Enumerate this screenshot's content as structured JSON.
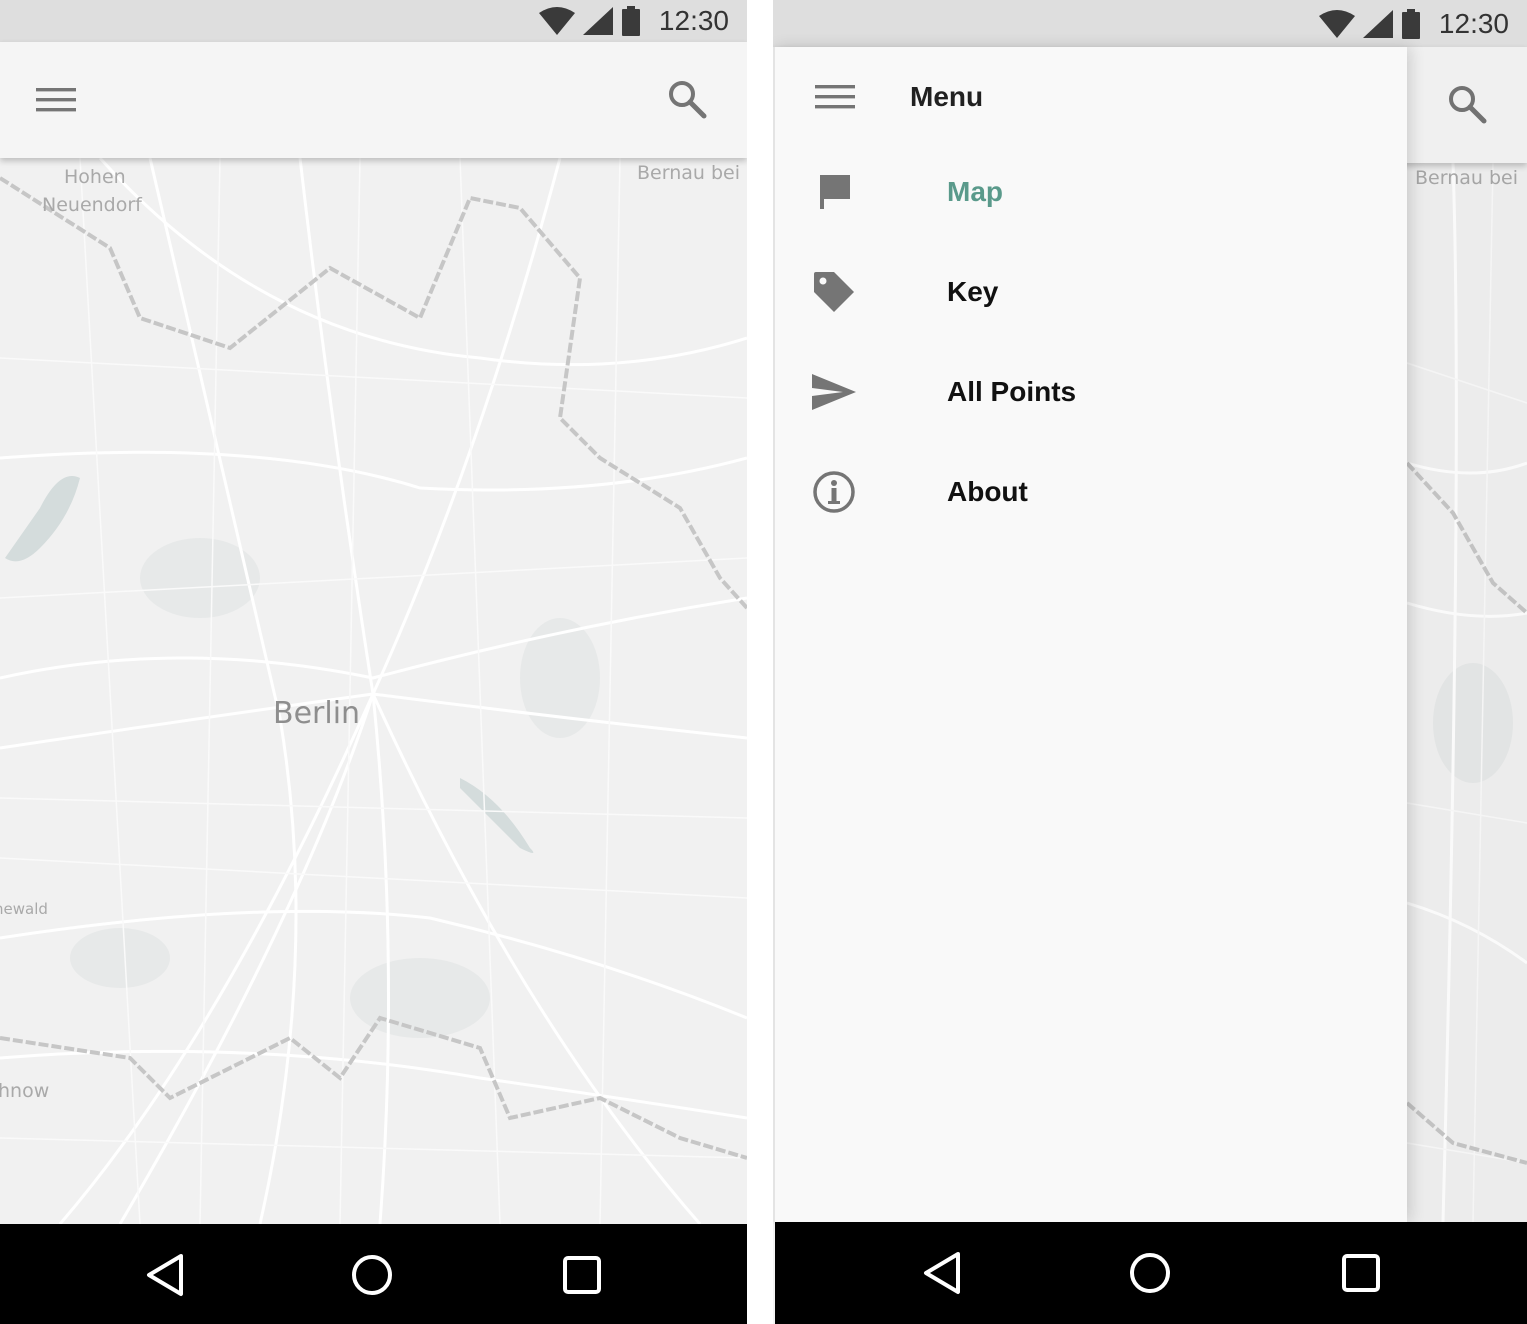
{
  "colors": {
    "accent": "#5a9a8b",
    "icon": "#757575",
    "status_bar": "#dedede",
    "app_bar": "#f5f5f5",
    "drawer": "#f9f9f9",
    "nav_bar": "#000000",
    "map_bg": "#f1f1f1"
  },
  "left_screen": {
    "status_bar": {
      "time": "12:30",
      "icons": [
        "wifi-icon",
        "cellular-signal-icon",
        "battery-icon"
      ]
    },
    "app_bar": {
      "menu_icon": "hamburger-menu-icon",
      "search_icon": "search-icon"
    },
    "map": {
      "city_label": "Berlin",
      "place_labels": {
        "hohen": "Hohen",
        "neuendorf": "Neuendorf",
        "bernau": "Bernau bei",
        "grunewald": "newald",
        "teltow": "hnow"
      }
    },
    "nav_bar": {
      "icons": [
        "back-icon",
        "home-icon",
        "recents-icon"
      ]
    }
  },
  "right_screen": {
    "status_bar": {
      "time": "12:30",
      "icons": [
        "wifi-icon",
        "cellular-signal-icon",
        "battery-icon"
      ]
    },
    "app_bar": {
      "search_icon": "search-icon"
    },
    "map": {
      "place_labels": {
        "bernau": "Bernau bei"
      }
    },
    "drawer": {
      "title": "Menu",
      "menu_icon": "hamburger-menu-icon",
      "items": [
        {
          "label": "Map",
          "icon": "flag-icon",
          "active": true
        },
        {
          "label": "Key",
          "icon": "tag-icon",
          "active": false
        },
        {
          "label": "All Points",
          "icon": "send-icon",
          "active": false
        },
        {
          "label": "About",
          "icon": "info-icon",
          "active": false
        }
      ]
    },
    "nav_bar": {
      "icons": [
        "back-icon",
        "home-icon",
        "recents-icon"
      ]
    }
  }
}
